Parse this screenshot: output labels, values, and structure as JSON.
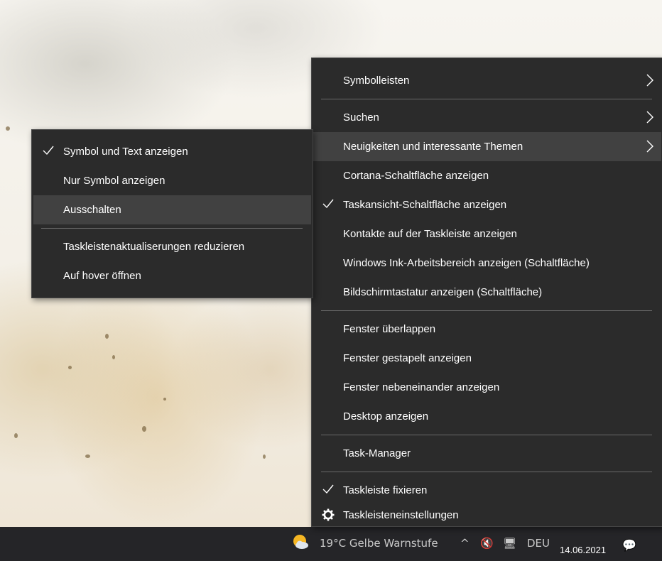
{
  "taskbar": {
    "weather_text": "19°C  Gelbe Warnstufe",
    "tray_chevron": "^",
    "language": "DEU",
    "date": "14.06.2021"
  },
  "main_menu": {
    "items": [
      {
        "label": "Symbolleisten",
        "has_submenu": true
      },
      {
        "label": "Suchen",
        "has_submenu": true
      },
      {
        "label": "Neuigkeiten und interessante Themen",
        "has_submenu": true,
        "highlighted": true
      },
      {
        "label": "Cortana-Schaltfläche anzeigen"
      },
      {
        "label": "Taskansicht-Schaltfläche anzeigen",
        "checked": true
      },
      {
        "label": "Kontakte auf der Taskleiste anzeigen"
      },
      {
        "label": "Windows Ink-Arbeitsbereich anzeigen (Schaltfläche)"
      },
      {
        "label": "Bildschirmtastatur anzeigen (Schaltfläche)"
      },
      {
        "label": "Fenster überlappen"
      },
      {
        "label": "Fenster gestapelt anzeigen"
      },
      {
        "label": "Fenster nebeneinander anzeigen"
      },
      {
        "label": "Desktop anzeigen"
      },
      {
        "label": "Task-Manager"
      },
      {
        "label": "Taskleiste fixieren",
        "checked": true
      },
      {
        "label": "Taskleisteneinstellungen",
        "icon": "gear-icon"
      }
    ]
  },
  "sub_menu": {
    "items": [
      {
        "label": "Symbol und Text anzeigen",
        "checked": true
      },
      {
        "label": "Nur Symbol anzeigen"
      },
      {
        "label": "Ausschalten",
        "highlighted": true
      },
      {
        "label": "Taskleistenaktualiserungen reduzieren"
      },
      {
        "label": "Auf hover öffnen"
      }
    ]
  },
  "colors": {
    "menu_bg": "#2b2b2b",
    "menu_hover": "#414141",
    "menu_text": "#ffffff",
    "taskbar_bg": "#252528"
  }
}
